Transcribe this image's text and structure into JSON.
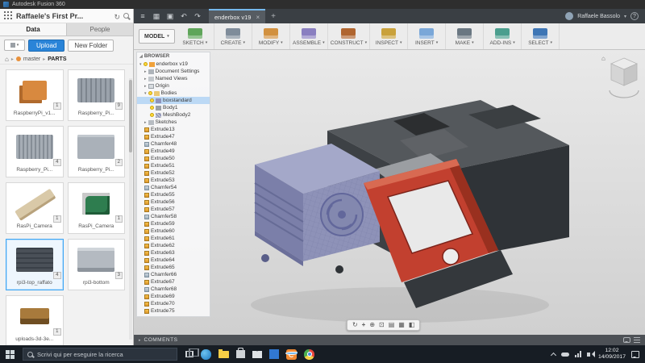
{
  "titlebar": {
    "app_title": "Autodesk Fusion 360"
  },
  "data_panel": {
    "title": "Raffaele's First Pr...",
    "tabs": [
      {
        "label": "Data"
      },
      {
        "label": "People"
      }
    ],
    "upload_label": "Upload",
    "new_folder_label": "New Folder",
    "breadcrumb": {
      "root": "master",
      "current": "PARTS"
    },
    "parts": [
      {
        "name": "RaspberryPi_v1...",
        "version": "1",
        "thumb": "orange-box",
        "state": ""
      },
      {
        "name": "Raspberry_Pi...",
        "version": "9",
        "thumb": "gray-case",
        "state": ""
      },
      {
        "name": "Raspberry_Pi...",
        "version": "4",
        "thumb": "vented-case",
        "state": ""
      },
      {
        "name": "Raspberry_Pi...",
        "version": "2",
        "thumb": "gray-case2",
        "state": ""
      },
      {
        "name": "RasPi_Camera",
        "version": "1",
        "thumb": "ribbon",
        "state": ""
      },
      {
        "name": "RasPi_Camera",
        "version": "1",
        "thumb": "pcb",
        "state": ""
      },
      {
        "name": "rpi3-top_raffato",
        "version": "4",
        "thumb": "dark-case",
        "state": "selected"
      },
      {
        "name": "rpi3-bottom",
        "version": "3",
        "thumb": "slot-case",
        "state": ""
      },
      {
        "name": "uploads-3d-3e...",
        "version": "1",
        "thumb": "connector",
        "state": ""
      }
    ]
  },
  "tabstrip": {
    "icons": [
      "file-menu-icon",
      "app-launcher-icon",
      "save-icon",
      "undo-icon",
      "redo-icon"
    ],
    "document_tab": "enderbox v19",
    "user_name": "Raffaele Bassolo"
  },
  "toolbar": {
    "workspace_label": "MODEL",
    "menus": [
      "SKETCH",
      "CREATE",
      "MODIFY",
      "ASSEMBLE",
      "CONSTRUCT",
      "INSPECT",
      "INSERT",
      "MAKE",
      "ADD-INS",
      "SELECT"
    ]
  },
  "browser": {
    "header": "BROWSER",
    "doc_title": "enderbox v19",
    "nodes": [
      {
        "label": "Document Settings",
        "icon": "ni-settings"
      },
      {
        "label": "Named Views",
        "icon": "ni-views"
      },
      {
        "label": "Origin",
        "icon": "ni-origin"
      }
    ],
    "bodies_label": "Bodies",
    "bodies": [
      {
        "label": "boxstandard",
        "icon": "ni-body-purple",
        "state": "selected"
      },
      {
        "label": "Body1",
        "icon": "ni-body-gray",
        "state": ""
      },
      {
        "label": "MeshBody2",
        "icon": "ni-body-mesh",
        "state": ""
      }
    ],
    "sketches_label": "Sketches",
    "features": [
      {
        "label": "Extrude13",
        "type": "extrude"
      },
      {
        "label": "Extrude47",
        "type": "extrude"
      },
      {
        "label": "Chamfer48",
        "type": "chamfer"
      },
      {
        "label": "Extrude49",
        "type": "extrude"
      },
      {
        "label": "Extrude50",
        "type": "extrude"
      },
      {
        "label": "Extrude51",
        "type": "extrude"
      },
      {
        "label": "Extrude52",
        "type": "extrude"
      },
      {
        "label": "Extrude53",
        "type": "extrude"
      },
      {
        "label": "Chamfer54",
        "type": "chamfer"
      },
      {
        "label": "Extrude55",
        "type": "extrude"
      },
      {
        "label": "Extrude56",
        "type": "extrude"
      },
      {
        "label": "Extrude57",
        "type": "extrude"
      },
      {
        "label": "Chamfer58",
        "type": "chamfer"
      },
      {
        "label": "Extrude59",
        "type": "extrude"
      },
      {
        "label": "Extrude60",
        "type": "extrude"
      },
      {
        "label": "Extrude61",
        "type": "extrude"
      },
      {
        "label": "Extrude62",
        "type": "extrude"
      },
      {
        "label": "Extrude63",
        "type": "extrude"
      },
      {
        "label": "Extrude64",
        "type": "extrude"
      },
      {
        "label": "Extrude65",
        "type": "extrude"
      },
      {
        "label": "Chamfer66",
        "type": "chamfer"
      },
      {
        "label": "Extrude67",
        "type": "extrude"
      },
      {
        "label": "Chamfer68",
        "type": "chamfer"
      },
      {
        "label": "Extrude69",
        "type": "extrude"
      },
      {
        "label": "Extrude70",
        "type": "extrude"
      },
      {
        "label": "Extrude75",
        "type": "extrude"
      }
    ]
  },
  "viewport": {
    "comments_label": "COMMENTS",
    "nav_icons": [
      "orbit-icon",
      "pan-icon",
      "zoom-icon",
      "fit-icon",
      "display-settings-icon",
      "grid-settings-icon",
      "viewports-icon"
    ],
    "model_colors": {
      "dark_body": "#3d4145",
      "purple_body": "#8e92b8",
      "red_plate": "#c2402f"
    }
  },
  "taskbar": {
    "search_placeholder": "Scrivi qui per eseguire la ricerca",
    "icons": [
      {
        "name": "task-view-icon",
        "cls": "ic-taskview"
      },
      {
        "name": "edge-icon",
        "cls": "ic-edge"
      },
      {
        "name": "file-explorer-icon",
        "cls": "ic-folder"
      },
      {
        "name": "store-icon",
        "cls": "ic-store"
      },
      {
        "name": "mail-icon",
        "cls": "ic-mail"
      },
      {
        "name": "photos-icon",
        "cls": "ic-photos"
      },
      {
        "name": "fusion-360-icon",
        "cls": "ic-fusion active"
      },
      {
        "name": "chrome-icon",
        "cls": "ic-chrome"
      }
    ],
    "time": "12:02",
    "date": "14/09/2017"
  }
}
